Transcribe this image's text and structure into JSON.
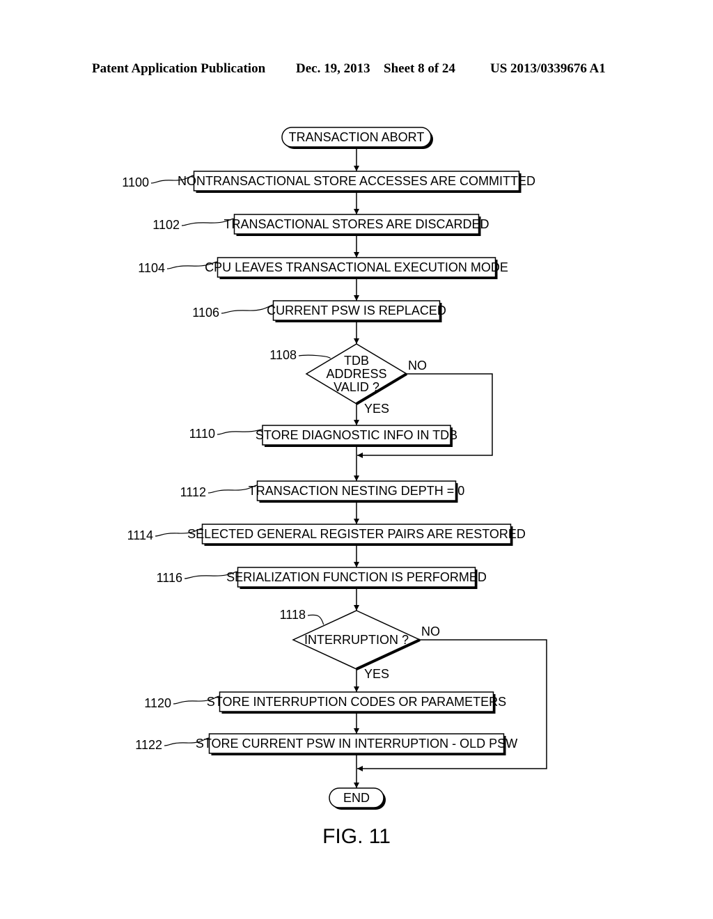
{
  "header": {
    "publication": "Patent Application Publication",
    "date": "Dec. 19, 2013",
    "sheet": "Sheet 8 of 24",
    "number": "US 2013/0339676 A1"
  },
  "figure": {
    "caption": "FIG. 11",
    "start": {
      "label": "TRANSACTION ABORT"
    },
    "end": {
      "label": "END"
    },
    "steps": [
      {
        "id": "s1100",
        "ref": "1100",
        "type": "process",
        "label": "NONTRANSACTIONAL STORE ACCESSES ARE COMMITTED"
      },
      {
        "id": "s1102",
        "ref": "1102",
        "type": "process",
        "label": "TRANSACTIONAL STORES ARE DISCARDED"
      },
      {
        "id": "s1104",
        "ref": "1104",
        "type": "process",
        "label": "CPU LEAVES TRANSACTIONAL EXECUTION MODE"
      },
      {
        "id": "s1106",
        "ref": "1106",
        "type": "process",
        "label": "CURRENT PSW IS REPLACED"
      },
      {
        "id": "s1108",
        "ref": "1108",
        "type": "decision",
        "label": [
          "TDB",
          "ADDRESS",
          "VALID ?"
        ],
        "yes": "YES",
        "no": "NO"
      },
      {
        "id": "s1110",
        "ref": "1110",
        "type": "process",
        "label": "STORE DIAGNOSTIC INFO IN TDB"
      },
      {
        "id": "s1112",
        "ref": "1112",
        "type": "process",
        "label": "TRANSACTION NESTING DEPTH = 0"
      },
      {
        "id": "s1114",
        "ref": "1114",
        "type": "process",
        "label": "SELECTED GENERAL REGISTER PAIRS ARE RESTORED"
      },
      {
        "id": "s1116",
        "ref": "1116",
        "type": "process",
        "label": "SERIALIZATION FUNCTION IS PERFORMED"
      },
      {
        "id": "s1118",
        "ref": "1118",
        "type": "decision",
        "label": [
          "INTERRUPTION ?"
        ],
        "yes": "YES",
        "no": "NO"
      },
      {
        "id": "s1120",
        "ref": "1120",
        "type": "process",
        "label": "STORE INTERRUPTION CODES OR PARAMETERS"
      },
      {
        "id": "s1122",
        "ref": "1122",
        "type": "process",
        "label": "STORE CURRENT PSW IN INTERRUPTION - OLD PSW"
      }
    ],
    "edges": [
      {
        "from": "start",
        "to": "s1100"
      },
      {
        "from": "s1100",
        "to": "s1102"
      },
      {
        "from": "s1102",
        "to": "s1104"
      },
      {
        "from": "s1104",
        "to": "s1106"
      },
      {
        "from": "s1106",
        "to": "s1108"
      },
      {
        "from": "s1108",
        "to": "s1110",
        "label": "YES"
      },
      {
        "from": "s1108",
        "to": "s1112",
        "label": "NO"
      },
      {
        "from": "s1110",
        "to": "s1112"
      },
      {
        "from": "s1112",
        "to": "s1114"
      },
      {
        "from": "s1114",
        "to": "s1116"
      },
      {
        "from": "s1116",
        "to": "s1118"
      },
      {
        "from": "s1118",
        "to": "s1120",
        "label": "YES"
      },
      {
        "from": "s1118",
        "to": "end",
        "label": "NO"
      },
      {
        "from": "s1120",
        "to": "s1122"
      },
      {
        "from": "s1122",
        "to": "end"
      }
    ]
  }
}
